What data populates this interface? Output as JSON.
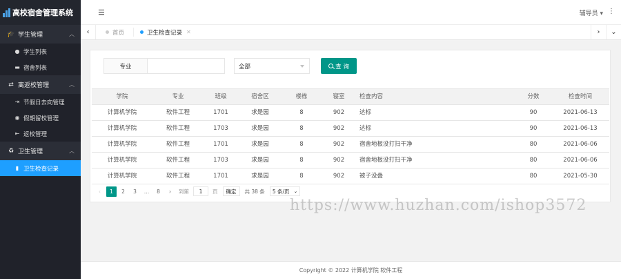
{
  "app": {
    "title": "高校宿舍管理系统"
  },
  "colors": {
    "sidebar_bg": "#20222a",
    "active_item": "#1e9fff",
    "primary_button": "#009688"
  },
  "sidebar": {
    "groups": [
      {
        "label": "学生管理",
        "icon": "graduation-cap-icon",
        "items": [
          {
            "label": "学生列表",
            "icon": "user-icon"
          },
          {
            "label": "宿舍列表",
            "icon": "bed-icon"
          }
        ]
      },
      {
        "label": "离返校管理",
        "icon": "exchange-icon",
        "items": [
          {
            "label": "节假日去向管理",
            "icon": "sign-out-icon"
          },
          {
            "label": "假期留校管理",
            "icon": "globe-icon"
          },
          {
            "label": "返校管理",
            "icon": "sign-in-icon"
          }
        ]
      },
      {
        "label": "卫生管理",
        "icon": "recycle-icon",
        "items": [
          {
            "label": "卫生检查记录",
            "icon": "bar-chart-icon",
            "active": true
          }
        ]
      }
    ]
  },
  "header": {
    "user_label": "辅导员"
  },
  "tabs": [
    {
      "label": "首页"
    },
    {
      "label": "卫生检查记录",
      "active": true
    }
  ],
  "search": {
    "field_label": "专业",
    "field_value": "",
    "select_value": "全部",
    "query_label": "查 询"
  },
  "table": {
    "columns": [
      "学院",
      "专业",
      "班级",
      "宿舍区",
      "楼栋",
      "寝室",
      "检查内容",
      "分数",
      "检查时间"
    ],
    "rows": [
      [
        "计算机学院",
        "软件工程",
        "1701",
        "求是园",
        "8",
        "902",
        "达标",
        "90",
        "2021-06-13"
      ],
      [
        "计算机学院",
        "软件工程",
        "1703",
        "求是园",
        "8",
        "902",
        "达标",
        "90",
        "2021-06-13"
      ],
      [
        "计算机学院",
        "软件工程",
        "1701",
        "求是园",
        "8",
        "902",
        "宿舍地板没打扫干净",
        "80",
        "2021-06-06"
      ],
      [
        "计算机学院",
        "软件工程",
        "1703",
        "求是园",
        "8",
        "902",
        "宿舍地板没打扫干净",
        "80",
        "2021-06-06"
      ],
      [
        "计算机学院",
        "软件工程",
        "1701",
        "求是园",
        "8",
        "902",
        "被子没叠",
        "80",
        "2021-05-30"
      ]
    ]
  },
  "pagination": {
    "prev": "‹",
    "next": "›",
    "pages": [
      "1",
      "2",
      "3",
      "…",
      "8"
    ],
    "goto_label": "到第",
    "goto_value": "1",
    "page_unit": "页",
    "confirm_label": "确定",
    "total_label": "共 38 条",
    "page_size_label": "5 条/页"
  },
  "footer": {
    "text": "Copyright © 2022 计算机学院 软件工程"
  },
  "watermark": {
    "text": "https://www.huzhan.com/ishop3572"
  }
}
